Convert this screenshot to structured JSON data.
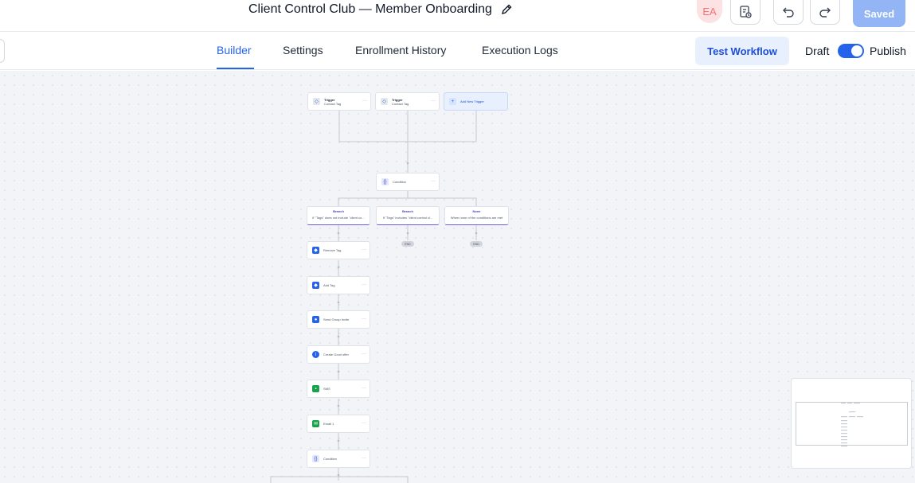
{
  "header": {
    "title": "Client Control Club — Member Onboarding",
    "avatar_initials": "EA",
    "saved_label": "Saved",
    "icons": [
      "edit-pencil-icon",
      "document-history-icon",
      "undo-icon",
      "redo-icon"
    ]
  },
  "tabs": [
    {
      "label": "Builder",
      "active": true
    },
    {
      "label": "Settings",
      "active": false
    },
    {
      "label": "Enrollment History",
      "active": false
    },
    {
      "label": "Execution Logs",
      "active": false
    }
  ],
  "actions": {
    "test_workflow_label": "Test Workflow",
    "draft_label": "Draft",
    "publish_label": "Publish",
    "publish_toggle_on": true
  },
  "workflow": {
    "triggers": [
      {
        "title": "Trigger",
        "subtitle": "Contact Tag"
      },
      {
        "title": "Trigger",
        "subtitle": "Contact Tag"
      }
    ],
    "add_trigger_label": "Add New Trigger",
    "condition_label": "Condition",
    "branches": [
      {
        "title": "Branch",
        "text": "if \"Tags\" does not include \"client co..."
      },
      {
        "title": "Branch",
        "text": "If \"Tags\" includes \"client control cl..."
      },
      {
        "title": "None",
        "text": "When none of the conditions are met"
      }
    ],
    "end_label": "END",
    "actions": [
      {
        "label": "Remove Tag",
        "icon": "tag-remove-icon"
      },
      {
        "label": "Add Tag",
        "icon": "tag-icon"
      },
      {
        "label": "Send Group Invite",
        "icon": "user-add-icon"
      },
      {
        "label": "Create Good offer",
        "icon": "info-icon"
      },
      {
        "label": "SMS",
        "icon": "sms-icon"
      },
      {
        "label": "Email 1",
        "icon": "email-icon"
      },
      {
        "label": "Condition",
        "icon": "condition-icon"
      }
    ]
  },
  "colors": {
    "accent": "#2563eb",
    "saved_bg": "#93b4f5",
    "canvas_bg": "#f2f4f7",
    "branch_accent": "#6d5be6",
    "avatar_bg": "#fde2e4"
  }
}
